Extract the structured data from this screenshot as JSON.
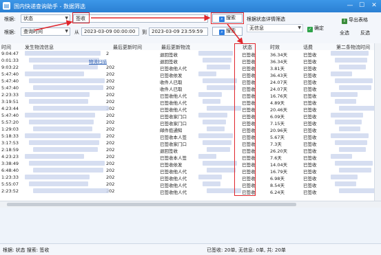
{
  "window": {
    "title": "国内快递查询助手 - 数据筛选",
    "app_icon": "app-logo-icon",
    "controls": [
      "—",
      "☐",
      "✕"
    ]
  },
  "filter": {
    "by_label": "根据:",
    "by_value": "状态",
    "status_value": "签收",
    "search_label": "搜索",
    "hint": "根据状态详情筛选",
    "time_label": "根据:",
    "time_value": "查询时间",
    "from_label": "从",
    "from_value": "2023-03-09 00:00:00",
    "to_label": "到",
    "to_value": "2023-03-09 23:59:59",
    "search2_label": "搜索",
    "mode_value": "无信息",
    "confirm_label": "确定",
    "export_label": "导出表格",
    "select_all_label": "全选",
    "invert_label": "反选"
  },
  "table": {
    "columns": [
      "时间",
      "发生物流信息",
      "最后更新时间",
      "最后更新物流",
      "状态",
      "时效",
      "话费",
      "第二条物流时间"
    ],
    "link_text": "物流扫描",
    "rows": [
      {
        "time": "9:04:47",
        "num": "2",
        "update": "退回签收",
        "status": "已签收",
        "dur": "36.34天",
        "fee": "已签收"
      },
      {
        "time": "0:01:33",
        "num": "",
        "update": "退回签收",
        "status": "已签收",
        "dur": "36.34天",
        "fee": "已签收"
      },
      {
        "time": "9:03:22",
        "num": "202",
        "update": "已签收他人代",
        "status": "已签收",
        "dur": "3.81天",
        "fee": "已签收"
      },
      {
        "time": "5:47:40",
        "num": "202",
        "update": "已签收依发",
        "status": "已签收",
        "dur": "36.43天",
        "fee": "已签收"
      },
      {
        "time": "5:47:40",
        "num": "202",
        "update": "收件人已取",
        "status": "已签收",
        "dur": "24.07天",
        "fee": "已签收"
      },
      {
        "time": "5:47:40",
        "num": "202",
        "update": "收件人已取",
        "status": "已签收",
        "dur": "24.07天",
        "fee": "已签收"
      },
      {
        "time": "2:23:33",
        "num": "202",
        "update": "已签收他人代",
        "status": "已签收",
        "dur": "16.76天",
        "fee": "已签收"
      },
      {
        "time": "3:19:51",
        "num": "202",
        "update": "已签收他人代",
        "status": "已签收",
        "dur": "4.89天",
        "fee": "已签收"
      },
      {
        "time": "4:23:44",
        "num": "202",
        "update": "已签收他人代",
        "status": "已签收",
        "dur": "20.46天",
        "fee": "已签收"
      },
      {
        "time": "5:47:40",
        "num": "202",
        "update": "已签收家门口",
        "status": "已签收",
        "dur": "6.09天",
        "fee": "已签收"
      },
      {
        "time": "5:57:20",
        "num": "202",
        "update": "已签收家门口",
        "status": "已签收",
        "dur": "7.15天",
        "fee": "已签收"
      },
      {
        "time": "1:29:03",
        "num": "202",
        "update": "邮件揽通知",
        "status": "已签收",
        "dur": "20.96天",
        "fee": "已签收"
      },
      {
        "time": "5:18:33",
        "num": "202",
        "update": "已签收本人签",
        "status": "已签收",
        "dur": "5.67天",
        "fee": "已签收"
      },
      {
        "time": "3:17:53",
        "num": "202",
        "update": "已签收家门口",
        "status": "已签收",
        "dur": "7.3天",
        "fee": "已签收"
      },
      {
        "time": "2:18:59",
        "num": "202",
        "update": "退回签收",
        "status": "已签收",
        "dur": "26.20天",
        "fee": "已签收"
      },
      {
        "time": "4:23:23",
        "num": "202",
        "update": "已签收本人签",
        "status": "已签收",
        "dur": "7.6天",
        "fee": "已签收"
      },
      {
        "time": "3:38:49",
        "num": "202",
        "update": "已签收依发",
        "status": "已签收",
        "dur": "14.04天",
        "fee": "已签收"
      },
      {
        "time": "6:48:40",
        "num": "202",
        "update": "已签收他人代",
        "status": "已签收",
        "dur": "16.79天",
        "fee": "已签收"
      },
      {
        "time": "1:23:33",
        "num": "202",
        "update": "已签收他人代",
        "status": "已签收",
        "dur": "6.98天",
        "fee": "已签收"
      },
      {
        "time": "5:55:07",
        "num": "202",
        "update": "已签收他人代",
        "status": "已签收",
        "dur": "8.54天",
        "fee": "已签收"
      },
      {
        "time": "2:23:52",
        "num": "202",
        "update": "已签收他人代",
        "status": "已签收",
        "dur": "6.24天",
        "fee": "已签收"
      }
    ]
  },
  "status": {
    "left": "根据: 状态 搜索: 签收",
    "right": "已签收: 20单, 无信息: 0单, 共: 20单"
  },
  "colors": {
    "accent": "#2b7de1",
    "highlight": "#e0242a",
    "titlebar": "#2a7fd3"
  }
}
